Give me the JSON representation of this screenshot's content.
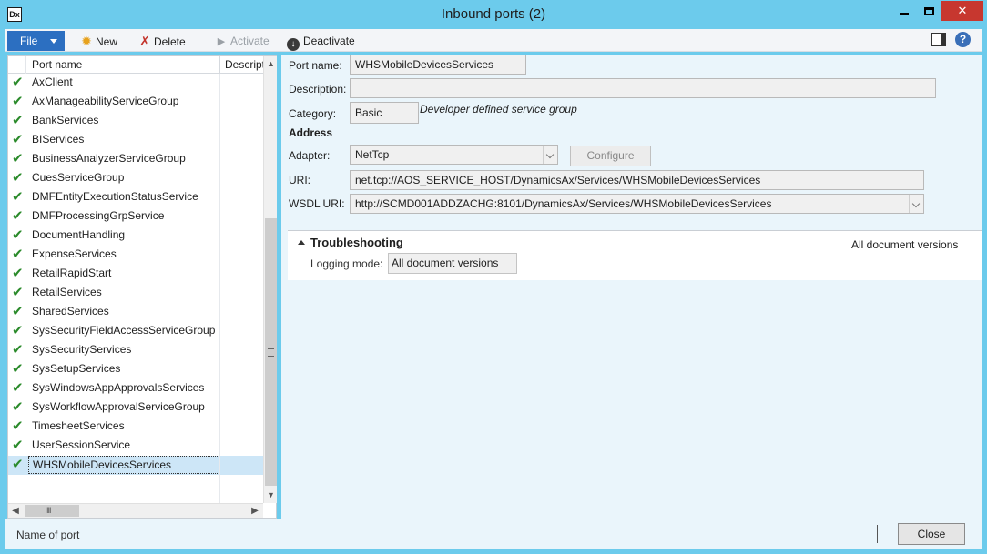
{
  "window": {
    "title": "Inbound ports (2)",
    "app_icon": "Dx",
    "close_glyph": "✕"
  },
  "toolbar": {
    "file_label": "File",
    "new_label": "New",
    "delete_label": "Delete",
    "activate_label": "Activate",
    "deactivate_label": "Deactivate",
    "help_glyph": "?"
  },
  "list": {
    "columns": [
      "Port name",
      "Descript"
    ],
    "rows": [
      "AxClient",
      "AxManageabilityServiceGroup",
      "BankServices",
      "BIServices",
      "BusinessAnalyzerServiceGroup",
      "CuesServiceGroup",
      "DMFEntityExecutionStatusService",
      "DMFProcessingGrpService",
      "DocumentHandling",
      "ExpenseServices",
      "RetailRapidStart",
      "RetailServices",
      "SharedServices",
      "SysSecurityFieldAccessServiceGroup",
      "SysSecurityServices",
      "SysSetupServices",
      "SysWindowsAppApprovalsServices",
      "SysWorkflowApprovalServiceGroup",
      "TimesheetServices",
      "UserSessionService",
      "WHSMobileDevicesServices"
    ],
    "selected_index": 20
  },
  "detail": {
    "port_name_label": "Port name:",
    "port_name_value": "WHSMobileDevicesServices",
    "description_label": "Description:",
    "description_value": "",
    "category_label": "Category:",
    "category_value": "Basic",
    "category_note": "Developer defined service group",
    "address_heading": "Address",
    "adapter_label": "Adapter:",
    "adapter_value": "NetTcp",
    "configure_label": "Configure",
    "uri_label": "URI:",
    "uri_value": "net.tcp://AOS_SERVICE_HOST/DynamicsAx/Services/WHSMobileDevicesServices",
    "wsdl_label": "WSDL URI:",
    "wsdl_value": "http://SCMD001ADDZACHG:8101/DynamicsAx/Services/WHSMobileDevicesServices"
  },
  "troubleshooting": {
    "title": "Troubleshooting",
    "summary": "All document versions",
    "logging_label": "Logging mode:",
    "logging_value": "All document versions"
  },
  "status": {
    "text": "Name of port",
    "close_label": "Close"
  },
  "colors": {
    "frame": "#6ccbec",
    "file_button": "#2c6fc1",
    "selection": "#cde6f7",
    "check": "#2a8a2a",
    "close_window": "#c7372f"
  }
}
